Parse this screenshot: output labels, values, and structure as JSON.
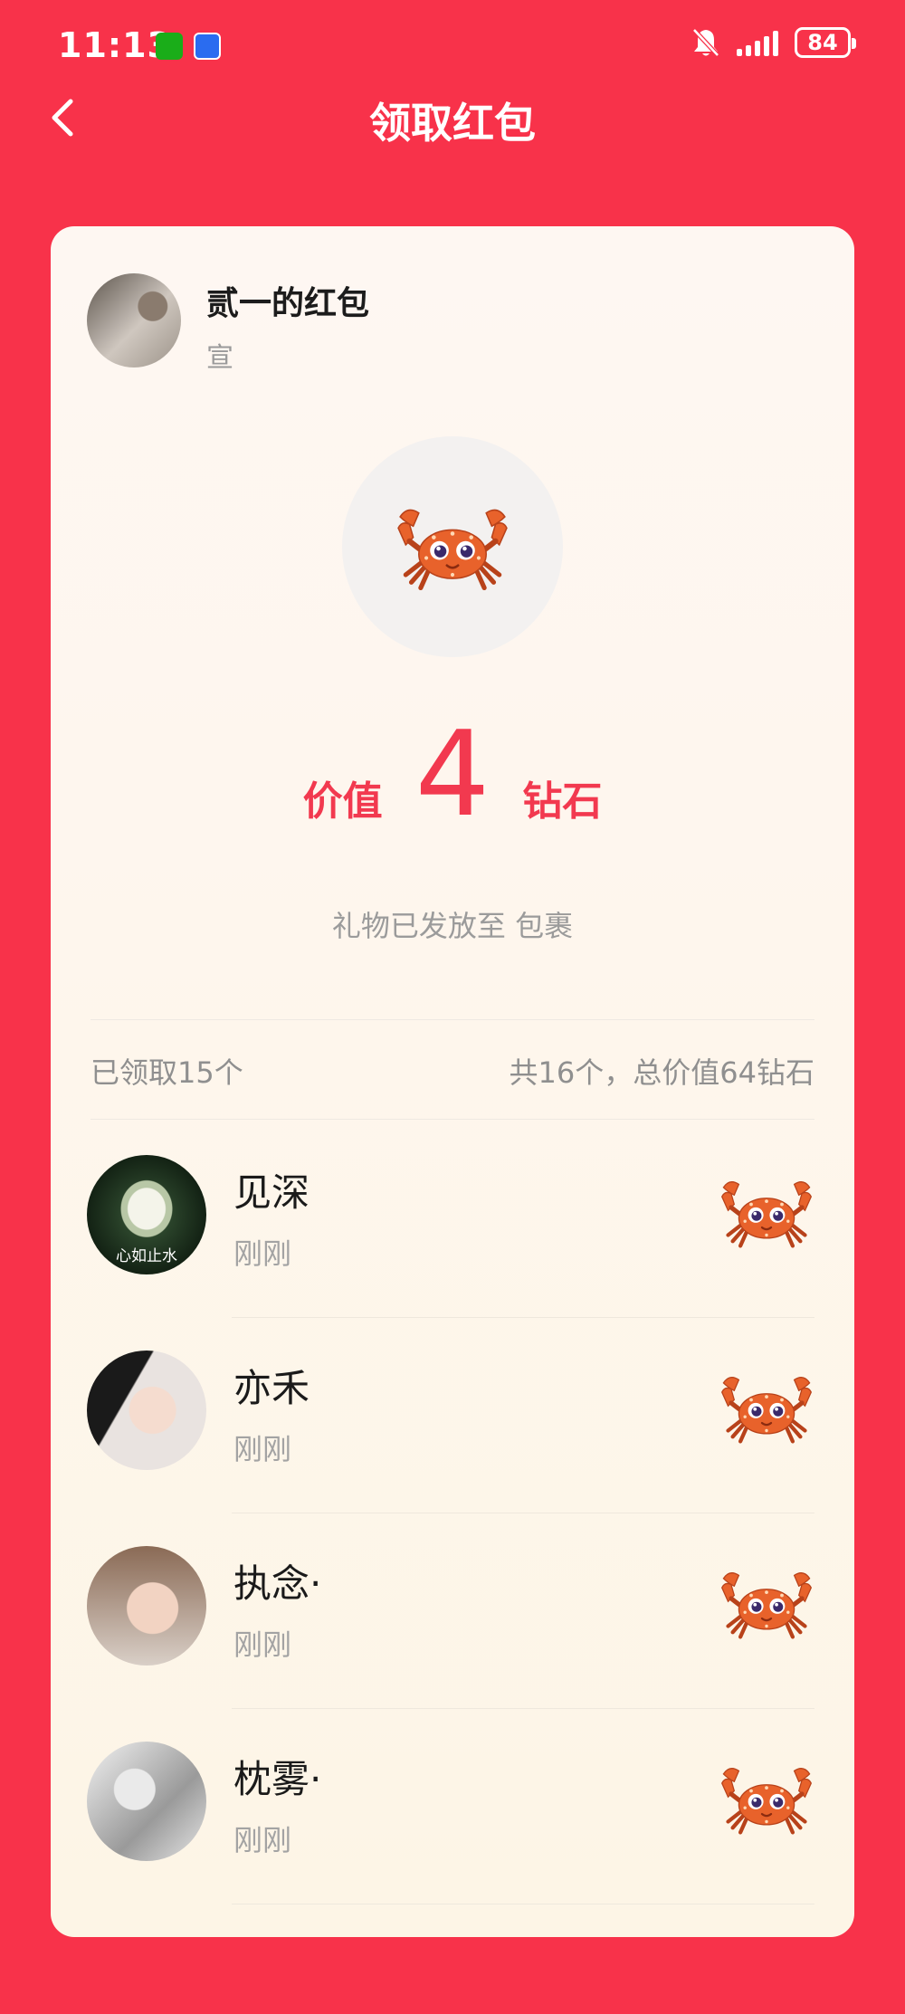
{
  "status_bar": {
    "time": "11:13",
    "battery": "84"
  },
  "nav": {
    "title": "领取红包"
  },
  "sender": {
    "name": "贰一的红包",
    "subtitle": "宣"
  },
  "gift": {
    "value_prefix": "价值",
    "value": "4",
    "value_unit": "钻石",
    "note": "礼物已发放至 包裹"
  },
  "summary": {
    "claimed": "已领取15个",
    "total": "共16个，总价值64钻石"
  },
  "recipients": [
    {
      "name": "见深",
      "time": "刚刚",
      "avatar_caption": "心如止水"
    },
    {
      "name": "亦禾",
      "time": "刚刚"
    },
    {
      "name": "执念·",
      "time": "刚刚"
    },
    {
      "name": "枕雾·",
      "time": "刚刚"
    }
  ],
  "colors": {
    "background": "#F8324A",
    "accent": "#F2394F",
    "card": "#FEF7F2"
  },
  "icons": {
    "back": "chevron-left-icon",
    "gift": "crab-icon",
    "notifications": "bell-off-icon"
  }
}
